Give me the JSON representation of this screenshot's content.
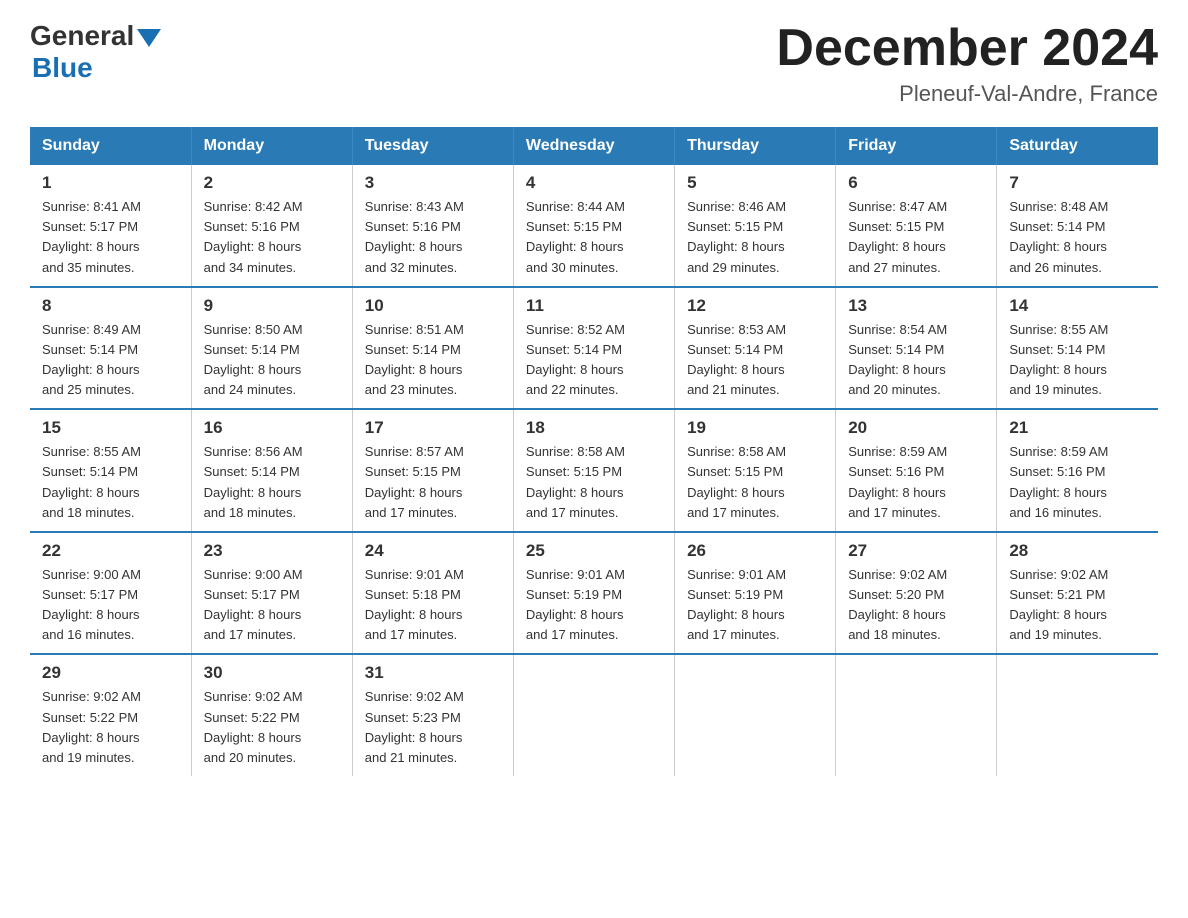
{
  "header": {
    "logo_general": "General",
    "logo_blue": "Blue",
    "month_title": "December 2024",
    "location": "Pleneuf-Val-Andre, France"
  },
  "days_of_week": [
    "Sunday",
    "Monday",
    "Tuesday",
    "Wednesday",
    "Thursday",
    "Friday",
    "Saturday"
  ],
  "weeks": [
    [
      {
        "day": "1",
        "sunrise": "8:41 AM",
        "sunset": "5:17 PM",
        "daylight": "8 hours and 35 minutes."
      },
      {
        "day": "2",
        "sunrise": "8:42 AM",
        "sunset": "5:16 PM",
        "daylight": "8 hours and 34 minutes."
      },
      {
        "day": "3",
        "sunrise": "8:43 AM",
        "sunset": "5:16 PM",
        "daylight": "8 hours and 32 minutes."
      },
      {
        "day": "4",
        "sunrise": "8:44 AM",
        "sunset": "5:15 PM",
        "daylight": "8 hours and 30 minutes."
      },
      {
        "day": "5",
        "sunrise": "8:46 AM",
        "sunset": "5:15 PM",
        "daylight": "8 hours and 29 minutes."
      },
      {
        "day": "6",
        "sunrise": "8:47 AM",
        "sunset": "5:15 PM",
        "daylight": "8 hours and 27 minutes."
      },
      {
        "day": "7",
        "sunrise": "8:48 AM",
        "sunset": "5:14 PM",
        "daylight": "8 hours and 26 minutes."
      }
    ],
    [
      {
        "day": "8",
        "sunrise": "8:49 AM",
        "sunset": "5:14 PM",
        "daylight": "8 hours and 25 minutes."
      },
      {
        "day": "9",
        "sunrise": "8:50 AM",
        "sunset": "5:14 PM",
        "daylight": "8 hours and 24 minutes."
      },
      {
        "day": "10",
        "sunrise": "8:51 AM",
        "sunset": "5:14 PM",
        "daylight": "8 hours and 23 minutes."
      },
      {
        "day": "11",
        "sunrise": "8:52 AM",
        "sunset": "5:14 PM",
        "daylight": "8 hours and 22 minutes."
      },
      {
        "day": "12",
        "sunrise": "8:53 AM",
        "sunset": "5:14 PM",
        "daylight": "8 hours and 21 minutes."
      },
      {
        "day": "13",
        "sunrise": "8:54 AM",
        "sunset": "5:14 PM",
        "daylight": "8 hours and 20 minutes."
      },
      {
        "day": "14",
        "sunrise": "8:55 AM",
        "sunset": "5:14 PM",
        "daylight": "8 hours and 19 minutes."
      }
    ],
    [
      {
        "day": "15",
        "sunrise": "8:55 AM",
        "sunset": "5:14 PM",
        "daylight": "8 hours and 18 minutes."
      },
      {
        "day": "16",
        "sunrise": "8:56 AM",
        "sunset": "5:14 PM",
        "daylight": "8 hours and 18 minutes."
      },
      {
        "day": "17",
        "sunrise": "8:57 AM",
        "sunset": "5:15 PM",
        "daylight": "8 hours and 17 minutes."
      },
      {
        "day": "18",
        "sunrise": "8:58 AM",
        "sunset": "5:15 PM",
        "daylight": "8 hours and 17 minutes."
      },
      {
        "day": "19",
        "sunrise": "8:58 AM",
        "sunset": "5:15 PM",
        "daylight": "8 hours and 17 minutes."
      },
      {
        "day": "20",
        "sunrise": "8:59 AM",
        "sunset": "5:16 PM",
        "daylight": "8 hours and 17 minutes."
      },
      {
        "day": "21",
        "sunrise": "8:59 AM",
        "sunset": "5:16 PM",
        "daylight": "8 hours and 16 minutes."
      }
    ],
    [
      {
        "day": "22",
        "sunrise": "9:00 AM",
        "sunset": "5:17 PM",
        "daylight": "8 hours and 16 minutes."
      },
      {
        "day": "23",
        "sunrise": "9:00 AM",
        "sunset": "5:17 PM",
        "daylight": "8 hours and 17 minutes."
      },
      {
        "day": "24",
        "sunrise": "9:01 AM",
        "sunset": "5:18 PM",
        "daylight": "8 hours and 17 minutes."
      },
      {
        "day": "25",
        "sunrise": "9:01 AM",
        "sunset": "5:19 PM",
        "daylight": "8 hours and 17 minutes."
      },
      {
        "day": "26",
        "sunrise": "9:01 AM",
        "sunset": "5:19 PM",
        "daylight": "8 hours and 17 minutes."
      },
      {
        "day": "27",
        "sunrise": "9:02 AM",
        "sunset": "5:20 PM",
        "daylight": "8 hours and 18 minutes."
      },
      {
        "day": "28",
        "sunrise": "9:02 AM",
        "sunset": "5:21 PM",
        "daylight": "8 hours and 19 minutes."
      }
    ],
    [
      {
        "day": "29",
        "sunrise": "9:02 AM",
        "sunset": "5:22 PM",
        "daylight": "8 hours and 19 minutes."
      },
      {
        "day": "30",
        "sunrise": "9:02 AM",
        "sunset": "5:22 PM",
        "daylight": "8 hours and 20 minutes."
      },
      {
        "day": "31",
        "sunrise": "9:02 AM",
        "sunset": "5:23 PM",
        "daylight": "8 hours and 21 minutes."
      },
      null,
      null,
      null,
      null
    ]
  ],
  "labels": {
    "sunrise": "Sunrise:",
    "sunset": "Sunset:",
    "daylight": "Daylight:"
  }
}
